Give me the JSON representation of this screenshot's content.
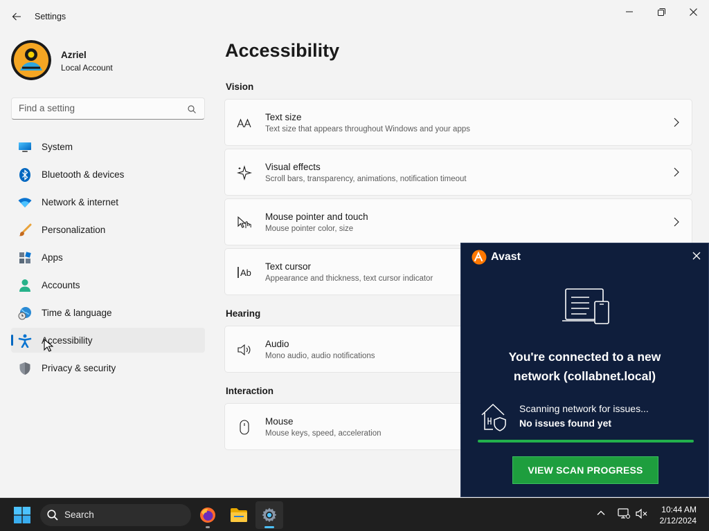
{
  "window": {
    "title": "Settings"
  },
  "profile": {
    "name": "Azriel",
    "account_type": "Local Account"
  },
  "search": {
    "placeholder": "Find a setting"
  },
  "nav": {
    "items": [
      {
        "label": "System",
        "icon": "monitor-icon"
      },
      {
        "label": "Bluetooth & devices",
        "icon": "bluetooth-icon"
      },
      {
        "label": "Network & internet",
        "icon": "wifi-icon"
      },
      {
        "label": "Personalization",
        "icon": "brush-icon"
      },
      {
        "label": "Apps",
        "icon": "apps-icon"
      },
      {
        "label": "Accounts",
        "icon": "person-icon"
      },
      {
        "label": "Time & language",
        "icon": "globe-clock-icon"
      },
      {
        "label": "Accessibility",
        "icon": "accessibility-icon",
        "active": true
      },
      {
        "label": "Privacy & security",
        "icon": "shield-icon"
      }
    ]
  },
  "main": {
    "title": "Accessibility",
    "sections": {
      "vision": "Vision",
      "hearing": "Hearing",
      "interaction": "Interaction"
    },
    "cards": {
      "text_size": {
        "title": "Text size",
        "subtitle": "Text size that appears throughout Windows and your apps"
      },
      "visual_effects": {
        "title": "Visual effects",
        "subtitle": "Scroll bars, transparency, animations, notification timeout"
      },
      "mouse_pointer": {
        "title": "Mouse pointer and touch",
        "subtitle": "Mouse pointer color, size"
      },
      "text_cursor": {
        "title": "Text cursor",
        "subtitle": "Appearance and thickness, text cursor indicator"
      },
      "audio": {
        "title": "Audio",
        "subtitle": "Mono audio, audio notifications"
      },
      "mouse": {
        "title": "Mouse",
        "subtitle": "Mouse keys, speed, acceleration"
      }
    }
  },
  "avast": {
    "brand": "Avast",
    "headline_line1": "You're connected to a new",
    "headline_line2": "network (collabnet.local)",
    "scan_status": "Scanning network for issues...",
    "scan_result": "No issues found yet",
    "progress": 1.0,
    "button": "VIEW SCAN PROGRESS",
    "accent": "#22b14c"
  },
  "taskbar": {
    "search_label": "Search",
    "time": "10:44 AM",
    "date": "2/12/2024"
  }
}
